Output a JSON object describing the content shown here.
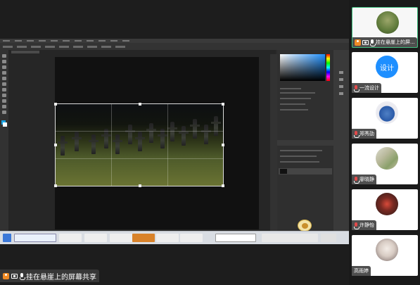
{
  "app": {
    "accent_color": "#1e8fff",
    "main_share_label": "挂在悬崖上的屏幕共享"
  },
  "participants": [
    {
      "name": "挂在悬崖上的屏...",
      "avatar": "green-plant-avatar",
      "active": true,
      "icons": [
        "person-icon",
        "share-icon",
        "mic-icon"
      ]
    },
    {
      "name": "一流设计",
      "avatar_text": "设计",
      "avatar_color": "#1e8fff",
      "icons": [
        "mic-icon"
      ]
    },
    {
      "name": "郑秀劭",
      "avatar": "blue-dome-avatar",
      "icons": [
        "mic-icon"
      ]
    },
    {
      "name": "廖晓静",
      "avatar": "photo-avatar",
      "icons": [
        "mic-icon"
      ]
    },
    {
      "name": "许静怡",
      "avatar": "red-dark-avatar",
      "icons": [
        "mic-icon"
      ]
    },
    {
      "name": "高雨婷",
      "avatar": "anime-girl-avatar",
      "icons": []
    }
  ]
}
